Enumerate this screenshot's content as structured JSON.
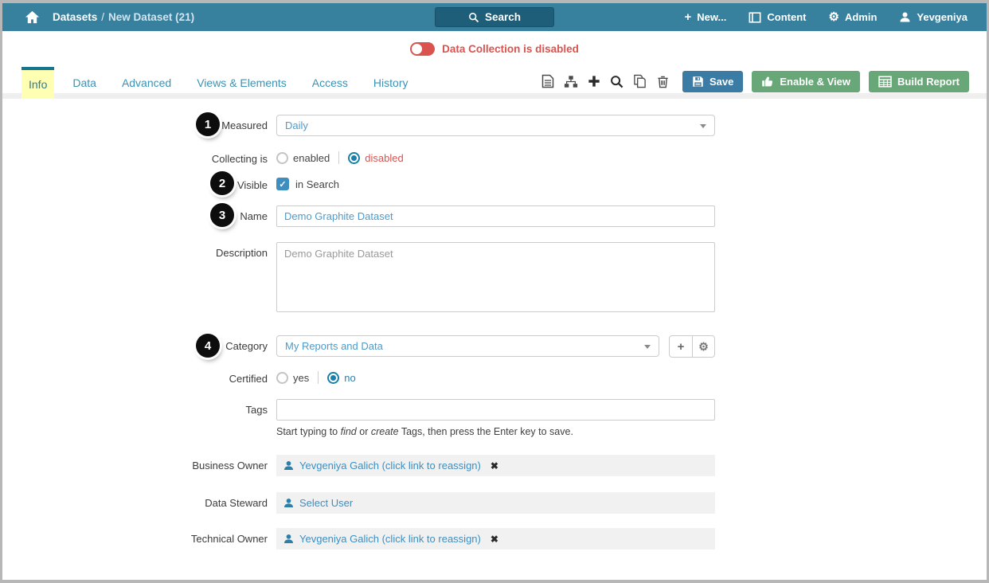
{
  "topbar": {
    "breadcrumb_section": "Datasets",
    "breadcrumb_sep": "/",
    "breadcrumb_page": "New Dataset (21)",
    "search_label": "Search",
    "new_label": "New...",
    "new_plus": "+",
    "content_label": "Content",
    "admin_label": "Admin",
    "admin_icon": "⚙",
    "user_label": "Yevgeniya"
  },
  "banner": {
    "label": "Data Collection is disabled"
  },
  "tabs": {
    "items": [
      {
        "label": "Info",
        "active": true
      },
      {
        "label": "Data",
        "active": false
      },
      {
        "label": "Advanced",
        "active": false
      },
      {
        "label": "Views & Elements",
        "active": false
      },
      {
        "label": "Access",
        "active": false
      },
      {
        "label": "History",
        "active": false
      }
    ]
  },
  "toolbar": {
    "icon_names": [
      "file-text-icon",
      "sitemap-icon",
      "add-icon",
      "search-icon",
      "copy-icon",
      "trash-icon"
    ],
    "save_label": "Save",
    "enable_view_label": "Enable & View",
    "build_report_label": "Build Report"
  },
  "form": {
    "measured": {
      "badge": "1",
      "label": "Measured",
      "value": "Daily"
    },
    "collecting": {
      "label": "Collecting is",
      "option_enabled": "enabled",
      "option_disabled": "disabled",
      "selected": "disabled"
    },
    "visible": {
      "badge": "2",
      "label": "Visible",
      "checkbox_label": "in Search",
      "checked": true,
      "check_glyph": "✓"
    },
    "name": {
      "badge": "3",
      "label": "Name",
      "value": "Demo Graphite Dataset"
    },
    "description": {
      "label": "Description",
      "value": "Demo Graphite Dataset"
    },
    "category": {
      "badge": "4",
      "label": "Category",
      "value": "My Reports and Data",
      "add_icon": "+",
      "gear_icon": "⚙"
    },
    "certified": {
      "label": "Certified",
      "option_yes": "yes",
      "option_no": "no",
      "selected": "no"
    },
    "tags": {
      "label": "Tags",
      "value": "",
      "helper_prefix": "Start typing to ",
      "helper_find": "find",
      "helper_or": " or ",
      "helper_create": "create",
      "helper_suffix": " Tags, then press the Enter key to save."
    },
    "business_owner": {
      "label": "Business Owner",
      "user": "Yevgeniya Galich",
      "hint": " (click link to reassign)",
      "remove_icon": "✖"
    },
    "data_steward": {
      "label": "Data Steward",
      "user": "Select User"
    },
    "technical_owner": {
      "label": "Technical Owner",
      "user": "Yevgeniya Galich",
      "hint": " (click link to reassign)",
      "remove_icon": "✖"
    }
  },
  "colors": {
    "topbar_teal": "#37809e",
    "search_button_teal": "#1f5e79",
    "status_red": "#d9534f",
    "tab_active_bg": "#ffffb3",
    "tab_active_border": "#15778e",
    "tab_link_blue": "#3a93b4",
    "save_blue": "#3a7ca6",
    "action_green": "#68a878",
    "value_blue": "#4d9bc9",
    "link_blue": "#3d8fc1",
    "owner_row_bg": "#f1f1f1"
  }
}
